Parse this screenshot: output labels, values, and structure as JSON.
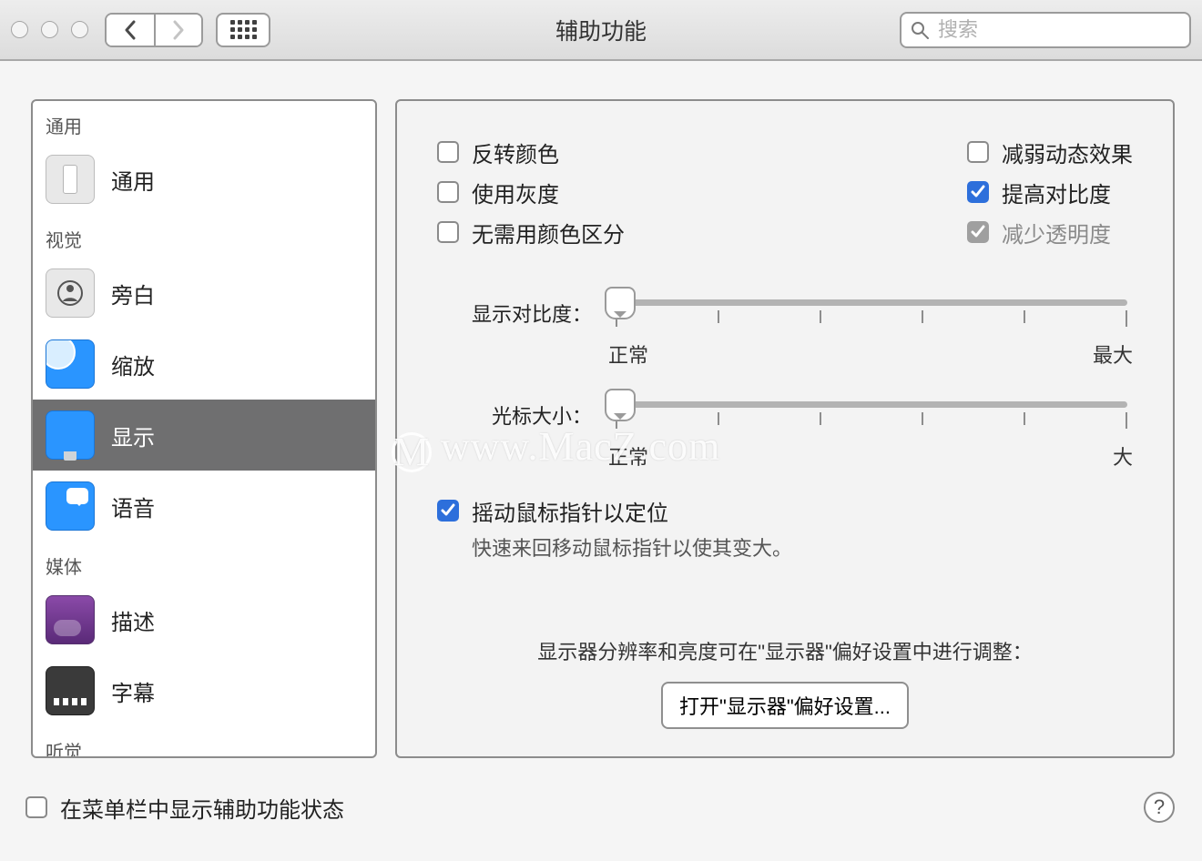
{
  "window": {
    "title": "辅助功能",
    "search_placeholder": "搜索"
  },
  "sidebar": {
    "sections": [
      {
        "label": "通用",
        "items": [
          {
            "id": "general",
            "label": "通用",
            "icon": "ic-general"
          }
        ]
      },
      {
        "label": "视觉",
        "items": [
          {
            "id": "voiceover",
            "label": "旁白",
            "icon": "ic-voiceover"
          },
          {
            "id": "zoom",
            "label": "缩放",
            "icon": "ic-zoom"
          },
          {
            "id": "display",
            "label": "显示",
            "icon": "ic-display",
            "selected": true
          },
          {
            "id": "speech",
            "label": "语音",
            "icon": "ic-speech"
          }
        ]
      },
      {
        "label": "媒体",
        "items": [
          {
            "id": "descriptions",
            "label": "描述",
            "icon": "ic-desc"
          },
          {
            "id": "captions",
            "label": "字幕",
            "icon": "ic-caption"
          }
        ]
      },
      {
        "label": "听觉",
        "items": []
      }
    ]
  },
  "panel": {
    "checks_left": [
      {
        "id": "invert",
        "label": "反转颜色",
        "checked": false
      },
      {
        "id": "gray",
        "label": "使用灰度",
        "checked": false
      },
      {
        "id": "nocolor",
        "label": "无需用颜色区分",
        "checked": false
      }
    ],
    "checks_right": [
      {
        "id": "reduceMotion",
        "label": "减弱动态效果",
        "checked": false
      },
      {
        "id": "increaseContrast",
        "label": "提高对比度",
        "checked": true
      },
      {
        "id": "reduceTransparency",
        "label": "减少透明度",
        "checked": true,
        "disabled": true
      }
    ],
    "slider_contrast": {
      "label": "显示对比度：",
      "min_label": "正常",
      "max_label": "最大",
      "value_pct": 0
    },
    "slider_cursor": {
      "label": "光标大小：",
      "min_label": "正常",
      "max_label": "大",
      "value_pct": 0
    },
    "shake": {
      "label": "摇动鼠标指针以定位",
      "sub": "快速来回移动鼠标指针以使其变大。",
      "checked": true
    },
    "hint": "显示器分辨率和亮度可在\"显示器\"偏好设置中进行调整：",
    "open_button": "打开\"显示器\"偏好设置..."
  },
  "footer": {
    "menubar_label": "在菜单栏中显示辅助功能状态",
    "menubar_checked": false
  },
  "watermark": "www.MacZ.com"
}
